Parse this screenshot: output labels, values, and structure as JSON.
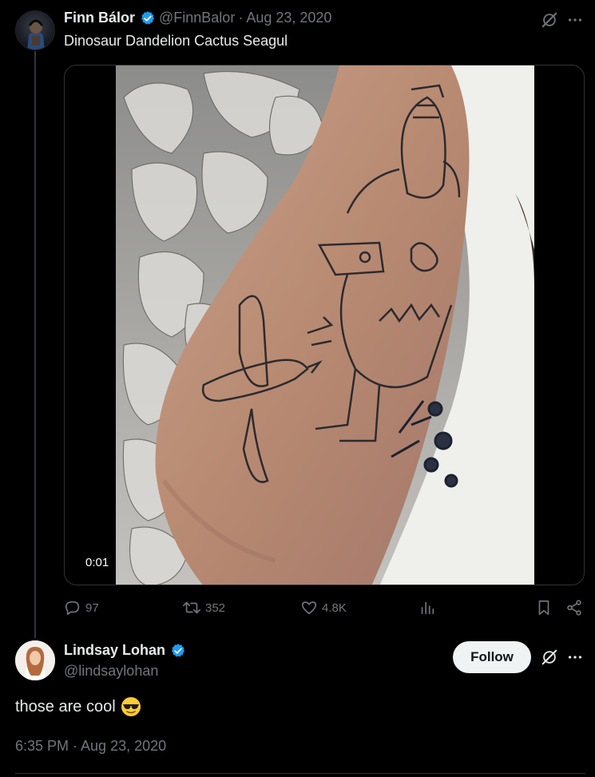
{
  "tweet": {
    "author_name": "Finn Bálor",
    "handle": "@FinnBalor",
    "separator": "·",
    "date": "Aug 23, 2020",
    "text": "Dinosaur Dandelion Cactus Seagul",
    "media_timecode": "0:01",
    "stats": {
      "replies": "97",
      "reposts": "352",
      "likes": "4.8K"
    }
  },
  "reply": {
    "author_name": "Lindsay Lohan",
    "handle": "@lindsaylohan",
    "follow_label": "Follow",
    "text": "those are cool",
    "emoji": "sunglasses-emoji",
    "timestamp": "6:35 PM · Aug 23, 2020"
  },
  "icons": {
    "verified": "verified-badge-icon",
    "grok": "grok-icon",
    "more": "more-icon",
    "reply": "reply-icon",
    "repost": "repost-icon",
    "like": "heart-icon",
    "views": "views-icon",
    "bookmark": "bookmark-icon",
    "share": "share-icon"
  },
  "colors": {
    "background": "#000000",
    "text": "#e7e9ea",
    "muted": "#71767b",
    "verified": "#1d9bf0",
    "follow_bg": "#eff3f4"
  }
}
